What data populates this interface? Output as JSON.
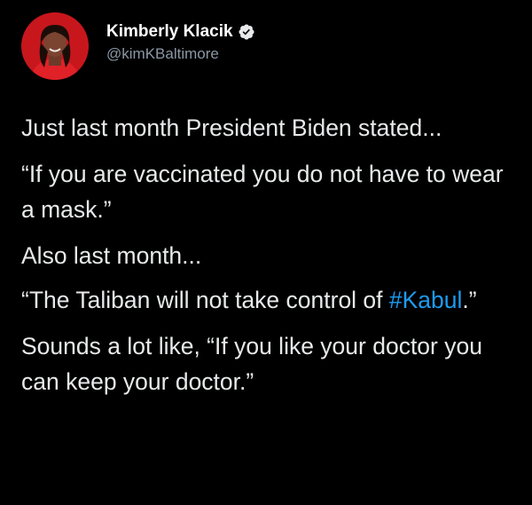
{
  "tweet": {
    "author": {
      "name": "Kimberly Klacik",
      "handle": "@kimKBaltimore",
      "verified": true
    },
    "paragraphs": [
      {
        "text": "Just last month President Biden stated..."
      },
      {
        "text": "“If you are vaccinated you do not have to wear a mask.”"
      },
      {
        "text": "Also last month..."
      },
      {
        "before": "“The Taliban will not take control of ",
        "hashtag": "#Kabul",
        "after": ".”"
      },
      {
        "text": "Sounds a lot like, “If you like your doctor you can keep your doctor.”"
      }
    ]
  },
  "colors": {
    "background": "#000000",
    "text": "#e7e9ea",
    "handle": "#8b98a5",
    "link": "#1d9bf0",
    "verified": "#1d9bf0",
    "avatar_bg": "#c8161d"
  },
  "icons": {
    "verified": "verified-badge-icon",
    "avatar": "profile-photo"
  }
}
